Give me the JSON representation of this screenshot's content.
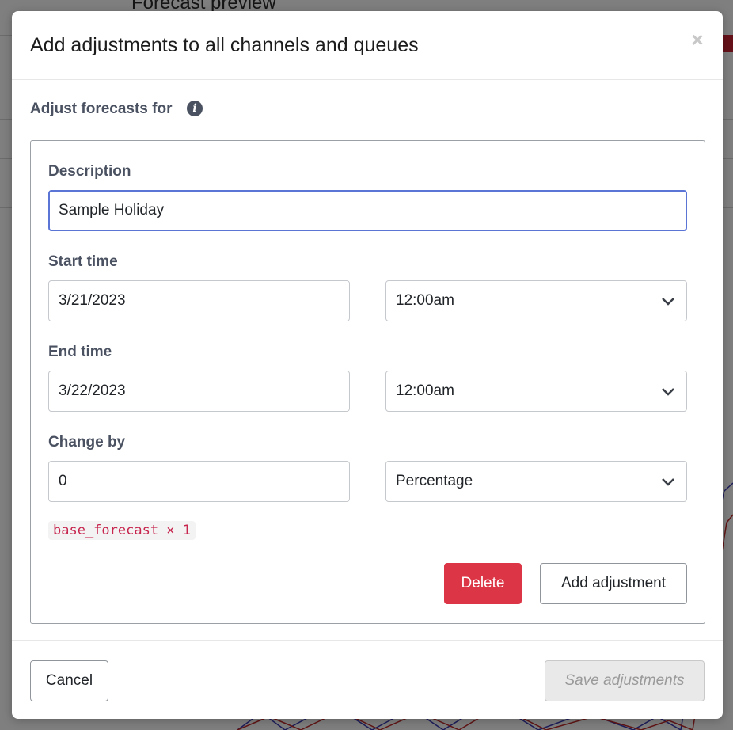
{
  "background": {
    "title": "Forecast preview"
  },
  "modal": {
    "title": "Add adjustments to all channels and queues",
    "close_glyph": "×",
    "section_label": "Adjust forecasts for",
    "info_glyph": "i",
    "adjustment": {
      "description_label": "Description",
      "description_value": "Sample Holiday",
      "start_label": "Start time",
      "start_date": "3/21/2023",
      "start_time": "12:00am",
      "end_label": "End time",
      "end_date": "3/22/2023",
      "end_time": "12:00am",
      "change_label": "Change by",
      "change_value": "0",
      "change_unit": "Percentage",
      "formula": "base_forecast × 1",
      "delete_label": "Delete",
      "add_label": "Add adjustment"
    },
    "footer": {
      "cancel_label": "Cancel",
      "save_label": "Save adjustments"
    }
  },
  "icons": {
    "close": "close-icon",
    "info": "info-icon",
    "chevron": "chevron-down-icon"
  },
  "colors": {
    "danger": "#dc3545",
    "focus_border": "#5b75d6",
    "label": "#4a5161",
    "formula_text": "#c7254e"
  }
}
